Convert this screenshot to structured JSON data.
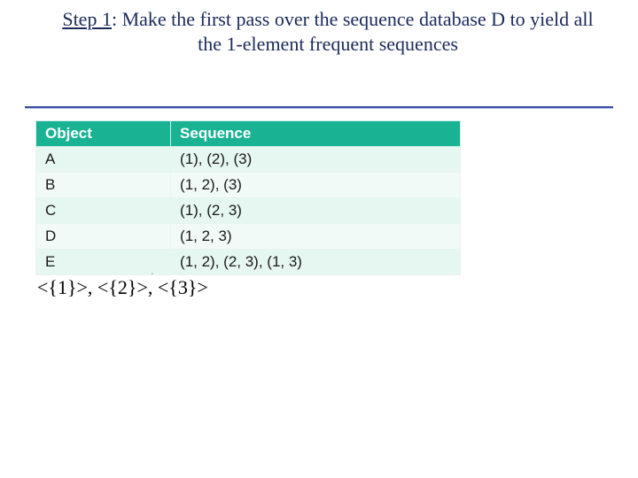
{
  "title": {
    "step_label": "Step 1",
    "rest": ": Make the first pass over the sequence database D to yield all the 1-element frequent sequences"
  },
  "table": {
    "headers": {
      "object": "Object",
      "sequence": "Sequence"
    },
    "rows": [
      {
        "object": "A",
        "sequence": "(1), (2), (3)"
      },
      {
        "object": "B",
        "sequence": "(1, 2), (3)"
      },
      {
        "object": "C",
        "sequence": "(1), (2, 3)"
      },
      {
        "object": "D",
        "sequence": "(1, 2, 3)"
      },
      {
        "object": "E",
        "sequence": "(1, 2), (2, 3), (1, 3)"
      }
    ]
  },
  "result_line": "<{1}>, <{2}>, <{3}>",
  "artifact": "."
}
